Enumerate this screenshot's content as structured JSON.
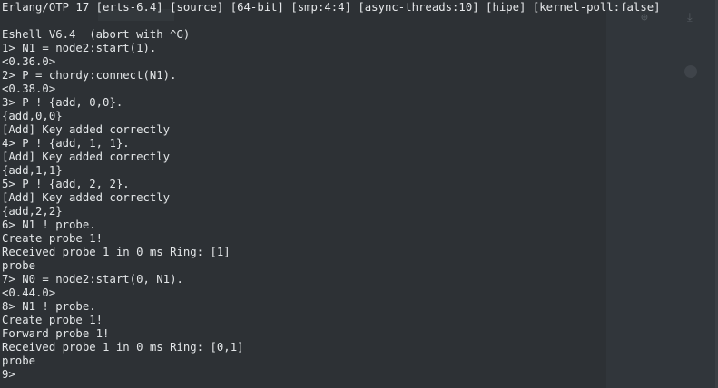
{
  "terminal": {
    "header": "Erlang/OTP 17 [erts-6.4] [source] [64-bit] [smp:4:4] [async-threads:10] [hipe] [kernel-poll:false]",
    "lines": [
      "Eshell V6.4  (abort with ^G)",
      "1> N1 = node2:start(1).",
      "<0.36.0>",
      "2> P = chordy:connect(N1).",
      "<0.38.0>",
      "3> P ! {add, 0,0}.",
      "{add,0,0}",
      "[Add] Key added correctly",
      "4> P ! {add, 1, 1}.",
      "[Add] Key added correctly",
      "{add,1,1}",
      "5> P ! {add, 2, 2}.",
      "[Add] Key added correctly",
      "{add,2,2}",
      "6> N1 ! probe.",
      "Create probe 1!",
      "Received probe 1 in 0 ms Ring: [1]",
      "probe",
      "7> N0 = node2:start(0, N1).",
      "<0.44.0>",
      "8> N1 ! probe.",
      "Create probe 1!",
      "Forward probe 1!",
      "Received probe 1 in 0 ms Ring: [0,1]",
      "probe",
      "9> "
    ]
  },
  "background": {
    "icons": [
      "user-add-icon",
      "download-icon",
      "avatar-icon"
    ]
  }
}
